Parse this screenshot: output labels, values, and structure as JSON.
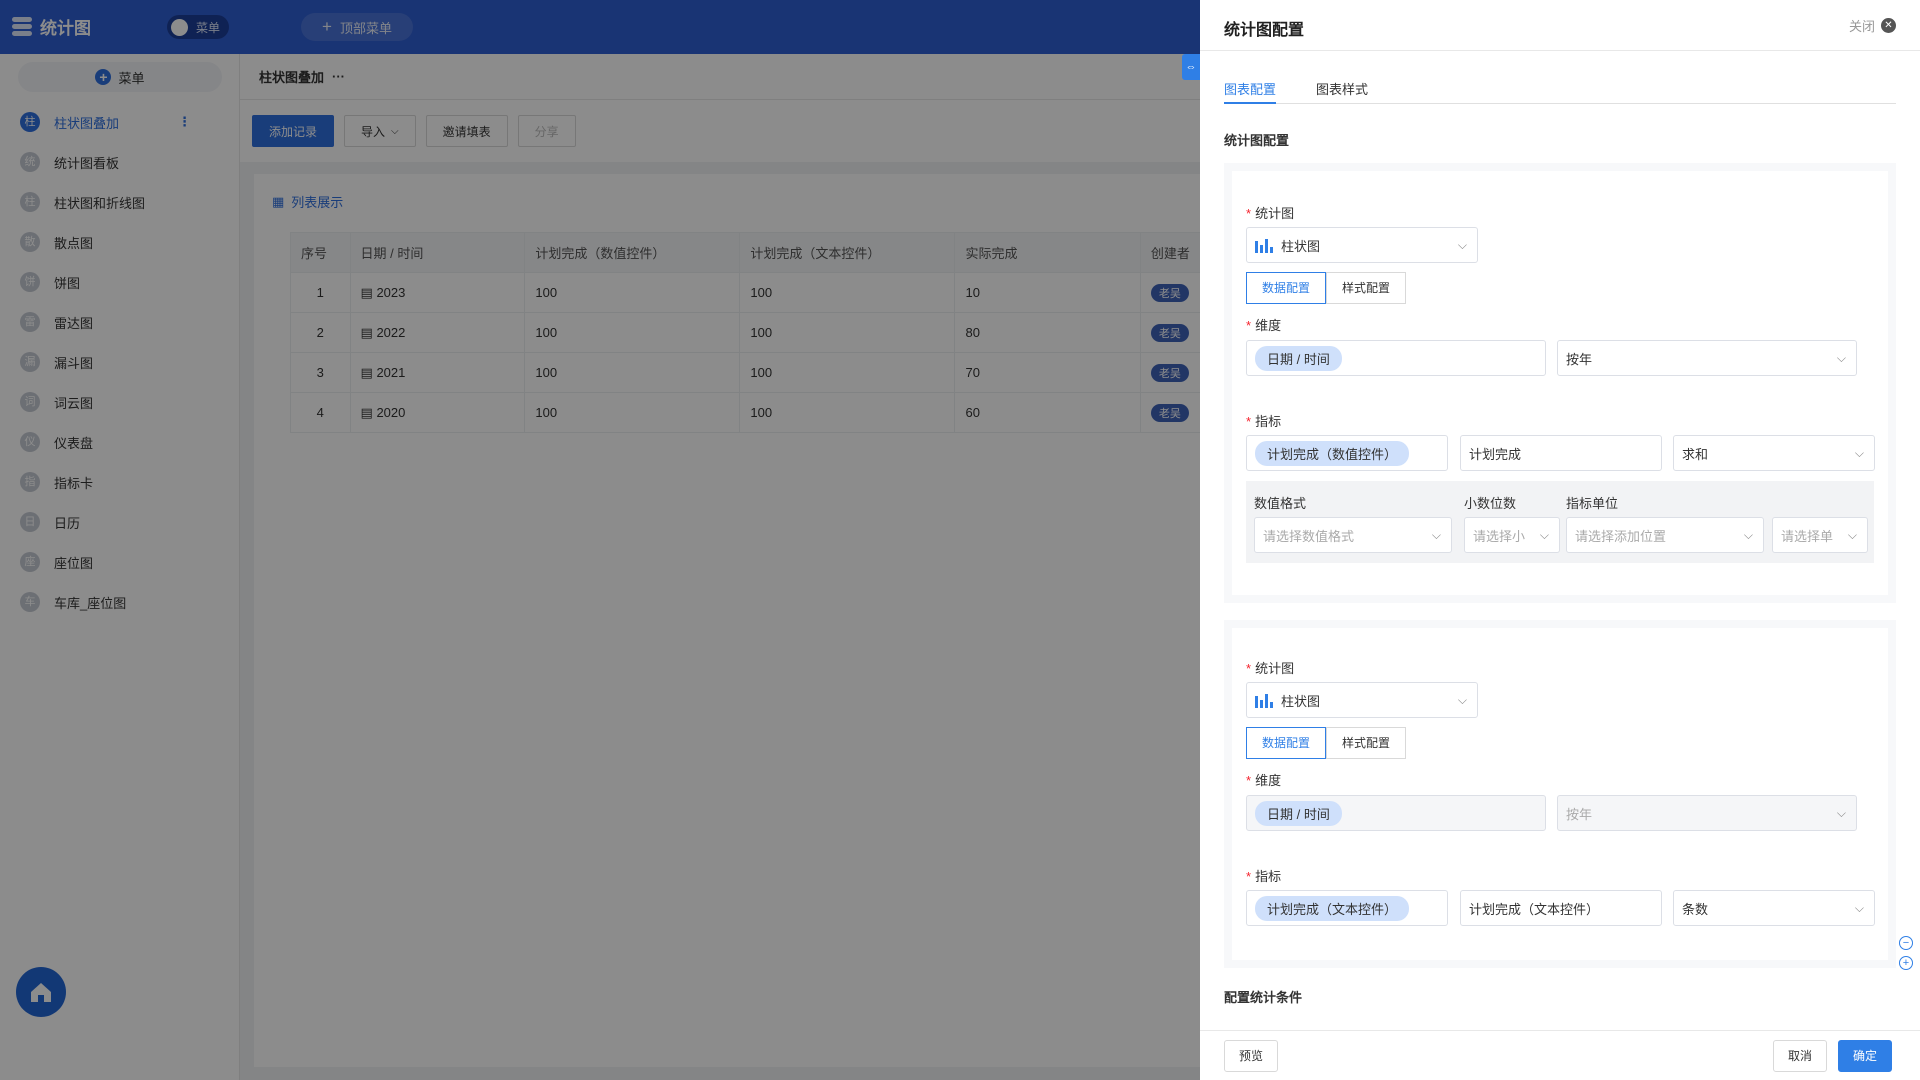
{
  "app": {
    "title": "统计图",
    "menu_toggle": "菜单",
    "top_menu": "顶部菜单"
  },
  "sidebar": {
    "menu_button": "菜单",
    "items": [
      {
        "badge": "柱",
        "label": "柱状图叠加",
        "active": true
      },
      {
        "badge": "统",
        "label": "统计图看板"
      },
      {
        "badge": "柱",
        "label": "柱状图和折线图"
      },
      {
        "badge": "散",
        "label": "散点图"
      },
      {
        "badge": "饼",
        "label": "饼图"
      },
      {
        "badge": "雷",
        "label": "雷达图"
      },
      {
        "badge": "漏",
        "label": "漏斗图"
      },
      {
        "badge": "词",
        "label": "词云图"
      },
      {
        "badge": "仪",
        "label": "仪表盘"
      },
      {
        "badge": "指",
        "label": "指标卡"
      },
      {
        "badge": "日",
        "label": "日历"
      },
      {
        "badge": "座",
        "label": "座位图"
      },
      {
        "badge": "车",
        "label": "车库_座位图"
      }
    ]
  },
  "page": {
    "title": "柱状图叠加",
    "more": "···",
    "toolbar": {
      "add": "添加记录",
      "import": "导入",
      "invite": "邀请填表",
      "share": "分享"
    },
    "list_title": "列表展示",
    "table": {
      "headers": [
        "序号",
        "日期 / 时间",
        "计划完成（数值控件）",
        "计划完成（文本控件）",
        "实际完成",
        "创建者"
      ],
      "rows": [
        {
          "no": "1",
          "date": "2023",
          "plan_num": "100",
          "plan_text": "100",
          "actual": "10",
          "creator": "老吴"
        },
        {
          "no": "2",
          "date": "2022",
          "plan_num": "100",
          "plan_text": "100",
          "actual": "80",
          "creator": "老吴"
        },
        {
          "no": "3",
          "date": "2021",
          "plan_num": "100",
          "plan_text": "100",
          "actual": "70",
          "creator": "老吴"
        },
        {
          "no": "4",
          "date": "2020",
          "plan_num": "100",
          "plan_text": "100",
          "actual": "60",
          "creator": "老吴"
        }
      ]
    }
  },
  "panel": {
    "title": "统计图配置",
    "close": "关闭",
    "tabs": [
      "图表配置",
      "图表样式"
    ],
    "section_title": "统计图配置",
    "config1": {
      "chart_label": "统计图",
      "chart_value": "柱状图",
      "seg_data": "数据配置",
      "seg_style": "样式配置",
      "dimension_label": "维度",
      "dimension_tag": "日期 / 时间",
      "dimension_group": "按年",
      "metric_label": "指标",
      "metric_tag": "计划完成（数值控件）",
      "metric_alias": "计划完成",
      "metric_agg": "求和",
      "format": {
        "num_format_label": "数值格式",
        "decimals_label": "小数位数",
        "unit_label": "指标单位",
        "num_format_ph": "请选择数值格式",
        "decimals_ph": "请选择小",
        "unit_pos_ph": "请选择添加位置",
        "unit_ph": "请选择单"
      }
    },
    "config2": {
      "chart_label": "统计图",
      "chart_value": "柱状图",
      "seg_data": "数据配置",
      "seg_style": "样式配置",
      "dimension_label": "维度",
      "dimension_tag": "日期 / 时间",
      "dimension_group": "按年",
      "metric_label": "指标",
      "metric_tag": "计划完成（文本控件）",
      "metric_alias": "计划完成（文本控件）",
      "metric_agg": "条数"
    },
    "condition_title": "配置统计条件",
    "footer": {
      "preview": "预览",
      "cancel": "取消",
      "confirm": "确定"
    }
  }
}
